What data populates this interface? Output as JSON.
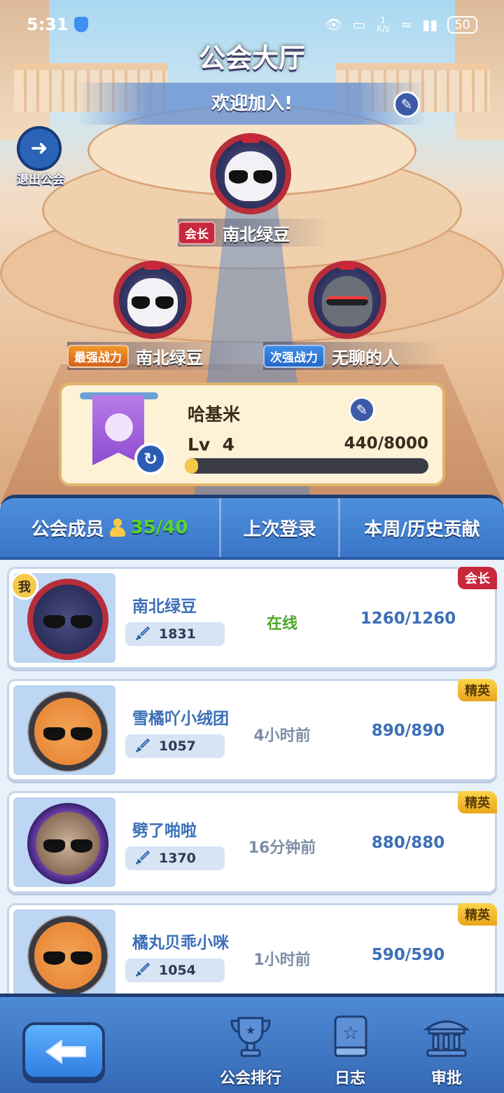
{
  "status_bar": {
    "time": "5:31",
    "net_speed": "1 K/s",
    "battery": "50"
  },
  "header": {
    "title": "公会大厅",
    "welcome": "欢迎加入!",
    "exit_label": "退出公会"
  },
  "leaders": {
    "president": {
      "role": "会长",
      "name": "南北绿豆"
    },
    "strongest": {
      "role": "最强战力",
      "name": "南北绿豆"
    },
    "second": {
      "role": "次强战力",
      "name": "无聊的人"
    }
  },
  "guild": {
    "name": "哈基米",
    "level_label": "Lv",
    "level": "4",
    "exp_text": "440/8000",
    "exp_fraction": 0.055
  },
  "members_header": {
    "members_label": "公会成员",
    "members_count": "35/40",
    "last_login_label": "上次登录",
    "contribution_label": "本周/历史贡献"
  },
  "members": [
    {
      "name": "南北绿豆",
      "power": "1831",
      "status": "在线",
      "contribution": "1260/1260",
      "rank": "会长",
      "me": "我"
    },
    {
      "name": "雪橘吖小绒团",
      "power": "1057",
      "status": "4小时前",
      "contribution": "890/890",
      "rank": "精英"
    },
    {
      "name": "劈了啪啦",
      "power": "1370",
      "status": "16分钟前",
      "contribution": "880/880",
      "rank": "精英"
    },
    {
      "name": "橘丸贝乖小咪",
      "power": "1054",
      "status": "1小时前",
      "contribution": "590/590",
      "rank": "精英"
    }
  ],
  "bottom_nav": {
    "ranking": "公会排行",
    "log": "日志",
    "approve": "审批"
  },
  "icons": {
    "exit": "exit-door-icon",
    "edit": "pencil-icon",
    "refresh": "refresh-icon",
    "sword": "sword-icon",
    "trophy": "trophy-icon",
    "book": "book-star-icon",
    "bank": "building-columns-icon",
    "back": "arrow-left-icon"
  },
  "colors": {
    "accent_blue": "#3975c7",
    "leader_red": "#c8283b",
    "elite_gold": "#f2bd33",
    "online_green": "#4ea82a"
  }
}
